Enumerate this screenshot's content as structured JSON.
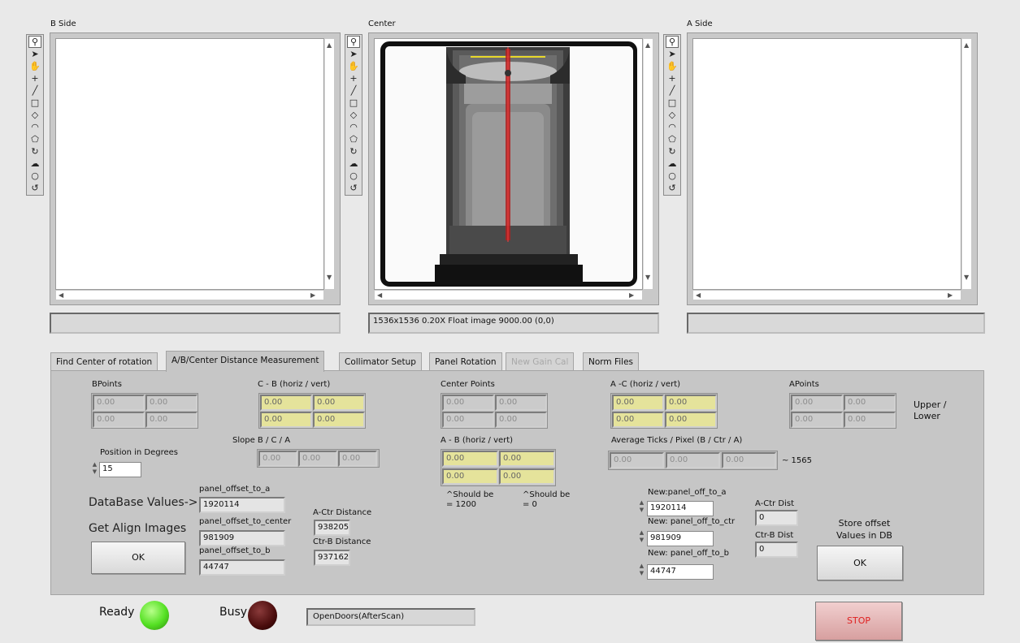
{
  "panels": {
    "b_side": {
      "title": "B Side",
      "status": ""
    },
    "center": {
      "title": "Center",
      "status": "1536x1536 0.20X Float image 9000.00    (0,0)"
    },
    "a_side": {
      "title": "A Side",
      "status": ""
    }
  },
  "toolbar_icons": [
    "zoom-icon",
    "pointer-icon",
    "pan-icon",
    "crosshair-icon",
    "line-icon",
    "rectangle-icon",
    "rotated-rect-icon",
    "annulus-icon",
    "polygon-icon",
    "freehand-icon",
    "freehand-region-icon",
    "oval-icon",
    "broken-annulus-icon"
  ],
  "tabs": [
    {
      "label": "Find Center of rotation",
      "state": "normal"
    },
    {
      "label": "A/B/Center Distance Measurement",
      "state": "active"
    },
    {
      "label": "Collimator Setup",
      "state": "normal"
    },
    {
      "label": "Panel Rotation",
      "state": "normal"
    },
    {
      "label": "New Gain Cal",
      "state": "disabled"
    },
    {
      "label": "Norm Files",
      "state": "normal"
    }
  ],
  "measure": {
    "bpoints_label": "BPoints",
    "bpoints": [
      "0.00",
      "0.00",
      "0.00",
      "0.00"
    ],
    "cb_label": "C - B (horiz / vert)",
    "cb": [
      "0.00",
      "0.00",
      "0.00",
      "0.00"
    ],
    "center_points_label": "Center Points",
    "center_points": [
      "0.00",
      "0.00",
      "0.00",
      "0.00"
    ],
    "ac_label": "A -C (horiz / vert)",
    "ac": [
      "0.00",
      "0.00",
      "0.00",
      "0.00"
    ],
    "apoints_label": "APoints",
    "apoints": [
      "0.00",
      "0.00",
      "0.00",
      "0.00"
    ],
    "upper_lower": "Upper /\nLower",
    "slope_label": "Slope B / C / A",
    "slope": [
      "0.00",
      "0.00",
      "0.00"
    ],
    "ab_label": "A - B (horiz / vert)",
    "ab": [
      "0.00",
      "0.00",
      "0.00",
      "0.00"
    ],
    "avg_ticks_label": "Average Ticks / Pixel (B / Ctr / A)",
    "avg_ticks": [
      "0.00",
      "0.00",
      "0.00"
    ],
    "approx": "~ 1565",
    "should_be_1": "^Should be\n= 1200",
    "should_be_2": "^Should be\n= 0",
    "position_label": "Position in Degrees",
    "position_value": "15"
  },
  "db": {
    "header": "DataBase Values->",
    "get_align": "Get Align Images",
    "ok": "OK",
    "offset_a_label": "panel_offset_to_a",
    "offset_a": "1920114",
    "offset_center_label": "panel_offset_to_center",
    "offset_center": "981909",
    "offset_b_label": "panel_offset_to_b",
    "offset_b": "44747",
    "actr_label": "A-Ctr Distance",
    "actr": "938205",
    "ctrb_label": "Ctr-B Distance",
    "ctrb": "937162"
  },
  "new_vals": {
    "a_label": "New:panel_off_to_a",
    "a": "1920114",
    "ctr_label": "New: panel_off_to_ctr",
    "ctr": "981909",
    "b_label": "New: panel_off_to_b",
    "b": "44747",
    "actr_dist_label": "A-Ctr Dist",
    "actr_dist": "0",
    "ctrb_dist_label": "Ctr-B Dist",
    "ctrb_dist": "0",
    "store_label": "Store offset\nValues in DB",
    "ok": "OK"
  },
  "status": {
    "ready": "Ready",
    "busy": "Busy",
    "message": "OpenDoors(AfterScan)",
    "stop": "STOP",
    "ready_color": "#54e023",
    "busy_color": "#4a0c0c",
    "stop_text_color": "#e02020"
  }
}
